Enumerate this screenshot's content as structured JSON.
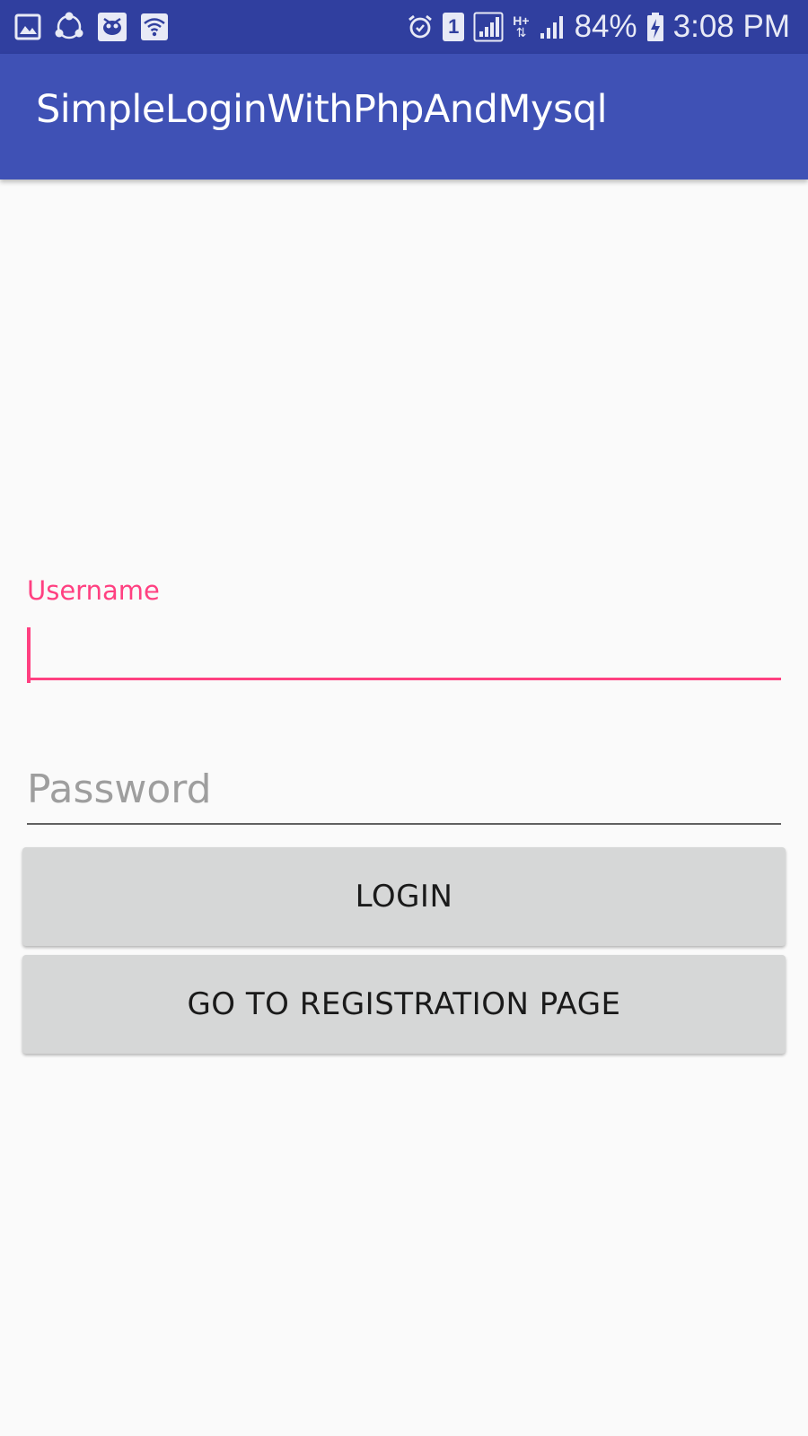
{
  "status_bar": {
    "battery_percent": "84%",
    "time": "3:08 PM",
    "sim_slot": "1",
    "network_type": "H+",
    "left_icons": [
      "gallery-icon",
      "share-sync-icon",
      "cleaner-app-icon",
      "wifi-icon"
    ],
    "right_icons": [
      "alarm-icon",
      "sim-1-icon",
      "signal-1-icon",
      "data-arrows-icon",
      "signal-2-icon",
      "battery-charging-icon"
    ],
    "background_color": "#303f9f"
  },
  "app_bar": {
    "title": "SimpleLoginWithPhpAndMysql",
    "background_color": "#3f51b5"
  },
  "form": {
    "username": {
      "label": "Username",
      "value": "",
      "accent_color": "#ff4081"
    },
    "password": {
      "placeholder": "Password",
      "value": ""
    },
    "login_button": {
      "label": "LOGIN"
    },
    "register_button": {
      "label": "GO TO REGISTRATION PAGE"
    }
  }
}
